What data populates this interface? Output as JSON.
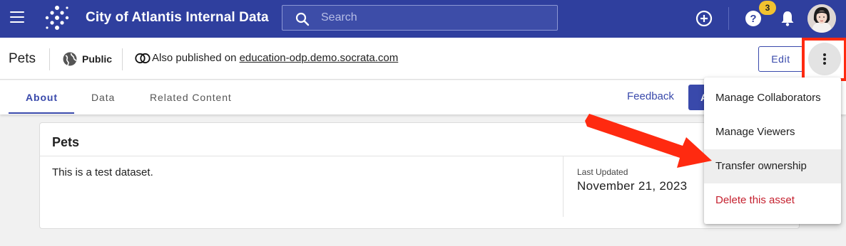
{
  "topbar": {
    "app_title": "City of Atlantis Internal Data",
    "search_placeholder": "Search",
    "help_badge_count": "3",
    "icons": [
      "menu-icon",
      "logo-icon",
      "search-icon",
      "add-circle-icon",
      "help-icon",
      "bell-icon",
      "avatar"
    ]
  },
  "asset": {
    "name": "Pets",
    "visibility": "Public",
    "published_prefix": "Also published on ",
    "published_link": "education-odp.demo.socrata.com",
    "edit_label": "Edit"
  },
  "tabs": {
    "items": [
      {
        "label": "About",
        "active": true
      },
      {
        "label": "Data",
        "active": false
      },
      {
        "label": "Related Content",
        "active": false
      }
    ],
    "feedback_label": "Feedback",
    "action_label": "A"
  },
  "card": {
    "title": "Pets",
    "description": "This is a test dataset.",
    "last_updated_label": "Last Updated",
    "last_updated_value": "November 21, 2023"
  },
  "menu": {
    "items": [
      {
        "label": "Manage Collaborators"
      },
      {
        "label": "Manage Viewers"
      },
      {
        "label": "Transfer ownership"
      },
      {
        "label": "Delete this asset"
      }
    ]
  },
  "colors": {
    "topbar": "#2f3f9e",
    "accent": "#3949ab",
    "annotation": "#ff2a10",
    "danger": "#c5202e",
    "badge": "#f2c230"
  }
}
